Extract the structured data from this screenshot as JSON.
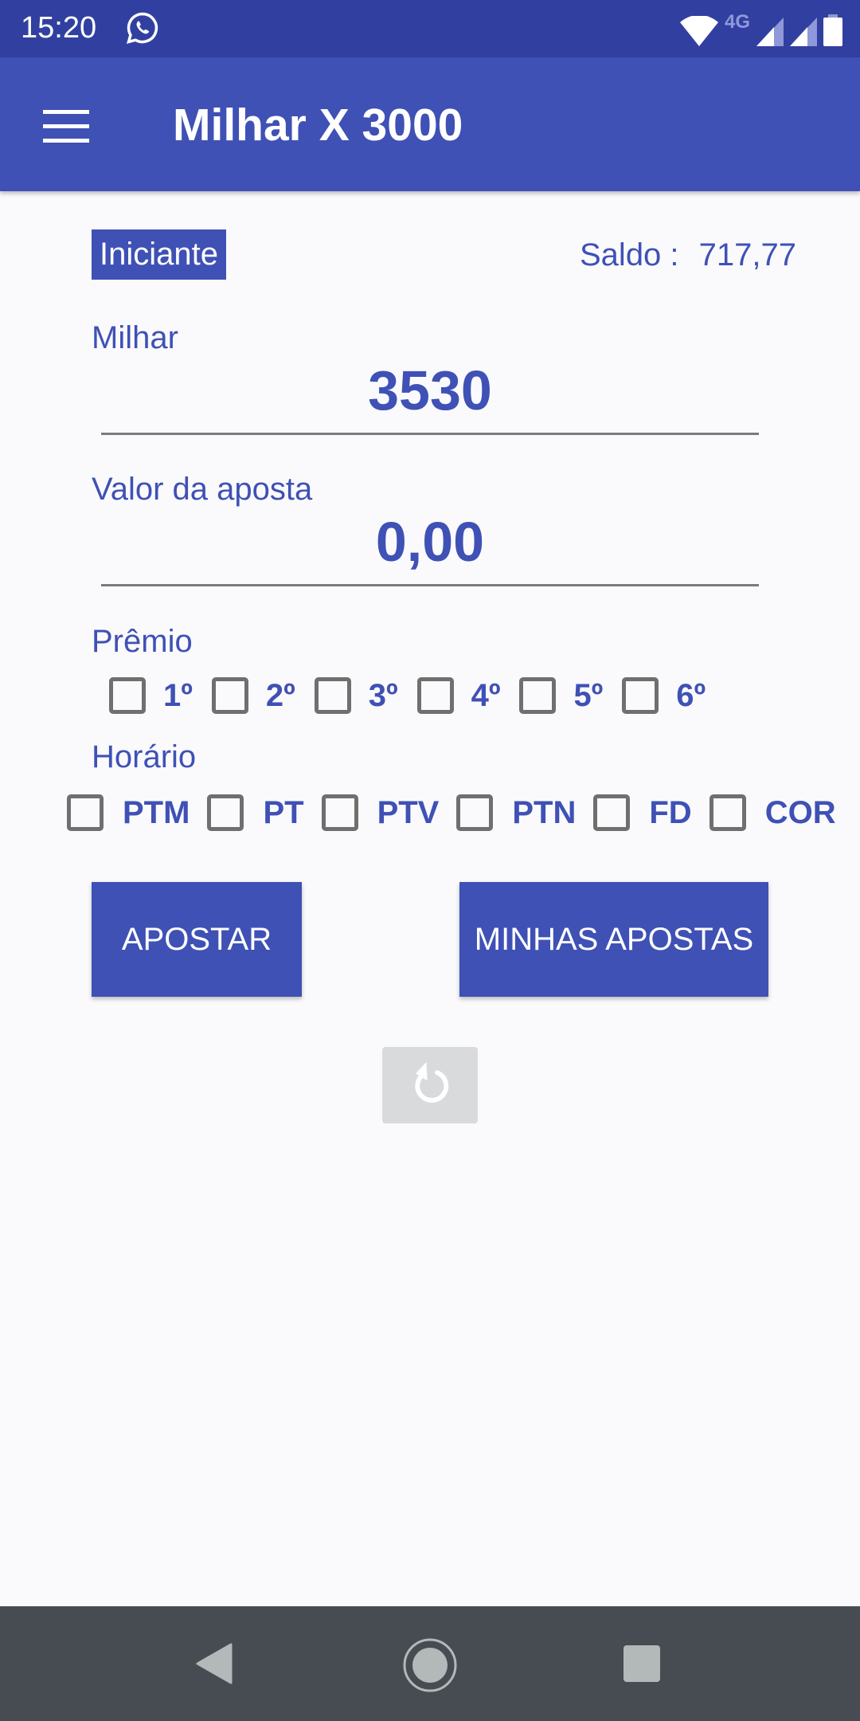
{
  "status_bar": {
    "time": "15:20",
    "notification_icons": [
      "whatsapp-icon"
    ],
    "system_icons": [
      "wifi-icon",
      "4g-icon",
      "signal-icon",
      "signal-icon",
      "battery-icon"
    ],
    "network_label": "4G"
  },
  "app_bar": {
    "title": "Milhar X 3000",
    "menu_icon": "menu-icon"
  },
  "header": {
    "level_badge": "Iniciante",
    "balance_label": "Saldo :",
    "balance_value": "717,77"
  },
  "form": {
    "milhar": {
      "label": "Milhar",
      "value": "3530"
    },
    "bet_value": {
      "label": "Valor da aposta",
      "value": "0,00"
    },
    "prize": {
      "label": "Prêmio",
      "options": [
        {
          "label": "1º",
          "checked": false
        },
        {
          "label": "2º",
          "checked": false
        },
        {
          "label": "3º",
          "checked": false
        },
        {
          "label": "4º",
          "checked": false
        },
        {
          "label": "5º",
          "checked": false
        },
        {
          "label": "6º",
          "checked": false
        }
      ]
    },
    "schedule": {
      "label": "Horário",
      "options": [
        {
          "label": "PTM",
          "checked": false
        },
        {
          "label": "PT",
          "checked": false
        },
        {
          "label": "PTV",
          "checked": false
        },
        {
          "label": "PTN",
          "checked": false
        },
        {
          "label": "FD",
          "checked": false
        },
        {
          "label": "COR",
          "checked": false
        }
      ]
    }
  },
  "actions": {
    "bet_button": "APOSTAR",
    "my_bets_button": "MINHAS APOSTAS",
    "refresh_icon": "refresh-icon"
  },
  "nav_bar": {
    "back": "back-icon",
    "home": "home-icon",
    "recents": "recents-icon"
  },
  "colors": {
    "primary": "#3f51b5",
    "primary_dark": "#3140a0",
    "background": "#fafafc",
    "checkbox_border": "#6f6f6f",
    "nav_bar": "#474c52"
  }
}
